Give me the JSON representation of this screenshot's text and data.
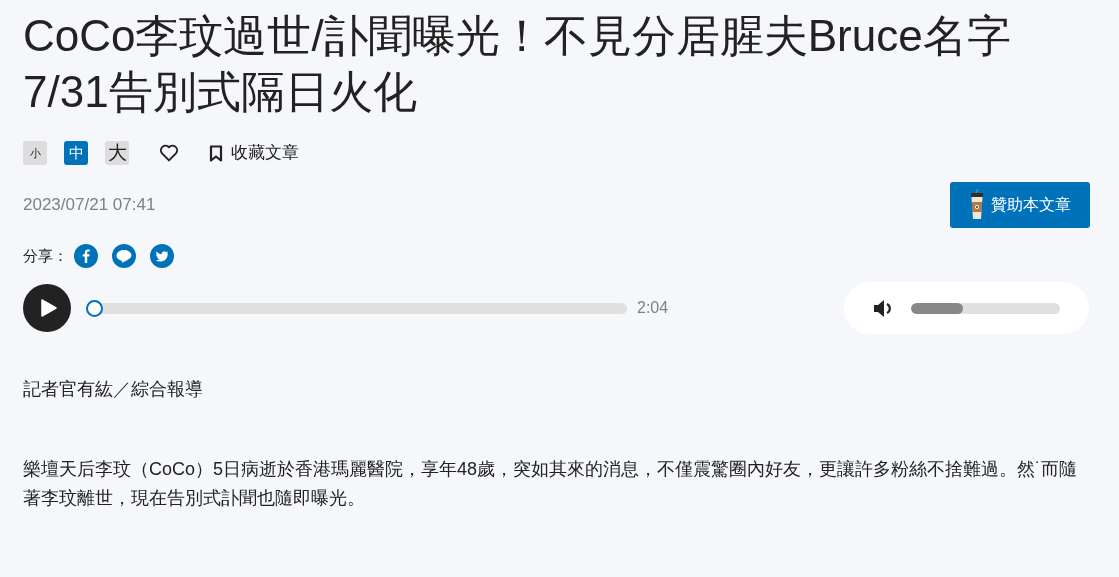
{
  "title": "CoCo李玟過世/訃聞曝光！不見分居腥夫Bruce名字7/31告別式隔日火化",
  "font_sizes": [
    {
      "label": "小",
      "selected": false
    },
    {
      "label": "中",
      "selected": true
    },
    {
      "label": "大",
      "selected": false
    }
  ],
  "bookmark": {
    "label": "收藏文章"
  },
  "date": "2023/07/21 07:41",
  "sponsor_button": "贊助本文章",
  "share": {
    "label": "分享："
  },
  "audio": {
    "level": 0,
    "duration": "2:04",
    "volume": {
      "level": 0.35
    }
  },
  "byline": "記者官有紘／綜合報導",
  "paragraphs": [
    "樂壇天后李玟（CoCo）5日病逝於香港瑪麗醫院，享年48歲，突如其來的消息，不僅震驚圈內好友，更讓許多粉絲不捨難過。然˙而隨著李玟離世，現在告別式訃聞也隨即曝光。"
  ]
}
